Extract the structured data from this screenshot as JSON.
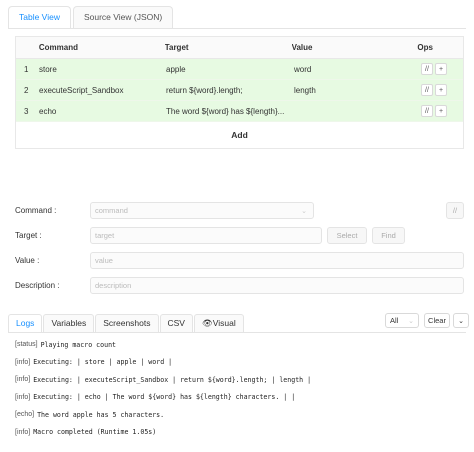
{
  "editor_tabs": [
    "Table View",
    "Source View (JSON)"
  ],
  "table": {
    "headers": {
      "command": "Command",
      "target": "Target",
      "value": "Value",
      "ops": "Ops"
    },
    "rows": [
      {
        "index": "1",
        "command": "store",
        "target": "apple",
        "value": "word"
      },
      {
        "index": "2",
        "command": "executeScript_Sandbox",
        "target": "return ${word}.length;",
        "value": "length"
      },
      {
        "index": "3",
        "command": "echo",
        "target": "The word ${word} has ${length}...",
        "value": ""
      }
    ],
    "op_labels": {
      "comment": "//",
      "insert": "+"
    },
    "add_label": "Add",
    "row_color": "#e7fae2"
  },
  "form": {
    "command_label": "Command",
    "command_placeholder": "command",
    "comment_toggle": "//",
    "target_label": "Target",
    "target_placeholder": "target",
    "select_label": "Select",
    "find_label": "Find",
    "value_label": "Value",
    "value_placeholder": "value",
    "description_label": "Description",
    "description_placeholder": "description"
  },
  "log_tabs": [
    "Logs",
    "Variables",
    "Screenshots",
    "CSV",
    "Visual"
  ],
  "log_controls": {
    "filter_value": "All",
    "clear_label": "Clear"
  },
  "logs": [
    {
      "type": "[status]",
      "text": "Playing macro count"
    },
    {
      "type": "[info]",
      "text": "Executing:  | store | apple | word |"
    },
    {
      "type": "[info]",
      "text": "Executing:  | executeScript_Sandbox | return ${word}.length; | length |"
    },
    {
      "type": "[info]",
      "text": "Executing:  | echo | The word ${word} has ${length} characters. |  |"
    },
    {
      "type": "[echo]",
      "text": "The word apple has 5 characters."
    },
    {
      "type": "[info]",
      "text": "Macro completed (Runtime 1.05s)"
    }
  ],
  "colors": {
    "accent": "#1890ff"
  }
}
